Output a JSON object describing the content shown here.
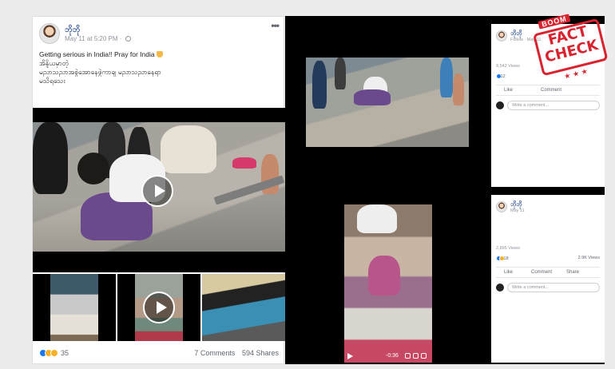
{
  "post": {
    "author": "ဘိုဘို",
    "meta": "May 11 at 5:20 PM",
    "text_line1": "Getting serious in India!! Pray for India",
    "text_line2": "အိန္ဒိယမှာတဲ့",
    "text_line3": "မညာသညာအစွဲအောနေဖွဲကာချ မညာသညာနေရာ",
    "text_line4": "မသိရသေး",
    "reaction_count": "35",
    "comments": "7 Comments",
    "shares": "594 Shares",
    "icons": [
      "globe-icon",
      "more-icon",
      "pray-icon",
      "play-icon",
      "like-reaction-icon",
      "wow-reaction-icon",
      "sad-reaction-icon"
    ]
  },
  "panel_top": {
    "author": "ဘိုဘို",
    "sub": "Follow · May 11",
    "views": "9,542 Views",
    "likes": "12",
    "like": "Like",
    "comment": "Comment",
    "comment_placeholder": "Write a comment..."
  },
  "panel_bottom": {
    "author": "ဘိုဘို",
    "sub": "May 11",
    "views": "2,895 Views",
    "likes": "18",
    "shares": "2.9K Views",
    "like": "Like",
    "comment": "Comment",
    "share": "Share",
    "comment_placeholder": "Write a comment...",
    "video_time": "-0:36"
  },
  "stamp": {
    "brand": "BOOM",
    "line1": "FACT",
    "line2": "CHECK",
    "stars": "★★★"
  },
  "colors": {
    "link_blue": "#385898",
    "stamp_red": "#d9232e",
    "like_blue": "#1877f2",
    "wow_yellow": "#f7b125"
  }
}
